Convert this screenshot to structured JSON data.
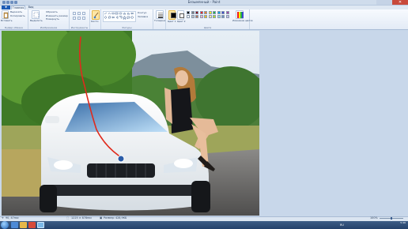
{
  "window": {
    "title": "Безымянный - Paint",
    "close_glyph": "✕"
  },
  "tabs": {
    "file": "▼",
    "home": "Главная",
    "view": "Вид"
  },
  "ribbon": {
    "clipboard": {
      "paste": "Вставить",
      "cut": "Вырезать",
      "copy": "Копировать",
      "group": "Буфер обмена"
    },
    "image": {
      "select": "Выделить",
      "crop": "Обрезать",
      "resize": "Изменить размер",
      "rotate": "Повернуть",
      "group": "Изображение"
    },
    "tools": {
      "group": "Инструменты"
    },
    "brushes": {
      "label": "Кисти"
    },
    "shapes": {
      "outline": "Контур",
      "fill": "Заливка",
      "group": "Фигуры"
    },
    "size": {
      "label": "Толщина"
    },
    "colors": {
      "color1": "Цвет 1",
      "color2": "Цвет 2",
      "edit": "Изменение цветов",
      "group": "Цвета",
      "color1_value": "#000000",
      "color2_value": "#ffffff",
      "palette": [
        "#000000",
        "#7f7f7f",
        "#880015",
        "#ed1c24",
        "#ff7f27",
        "#fff200",
        "#22b14c",
        "#00a2e8",
        "#3f48cc",
        "#a349a4",
        "#ffffff",
        "#c3c3c3",
        "#b97a57",
        "#ffaec9",
        "#ffc90e",
        "#efe4b0",
        "#b5e61d",
        "#99d9ea",
        "#7092be",
        "#c8bfe7"
      ]
    }
  },
  "status": {
    "cursor_pos": "90, 47пкс",
    "selection_size": "1225 × 878пкс",
    "file_size": "Размер: 428,9КБ",
    "zoom": "100%"
  },
  "taskbar": {
    "lang": "RU",
    "time": "5:46"
  },
  "canvas": {
    "brush_color": "#e02a1c"
  }
}
